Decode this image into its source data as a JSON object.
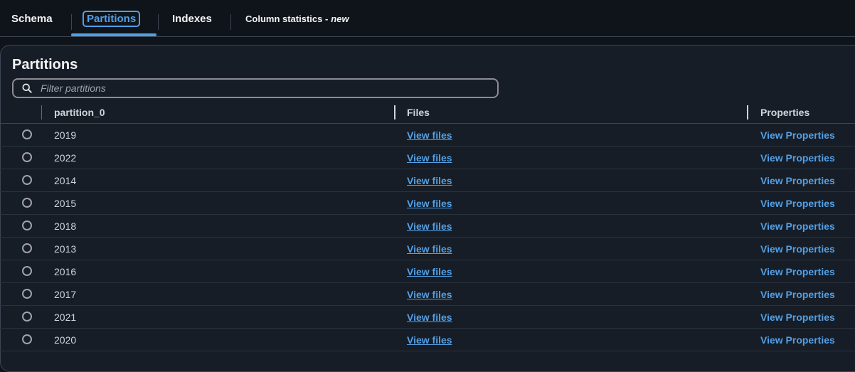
{
  "tabs": [
    {
      "label": "Schema"
    },
    {
      "label": "Partitions"
    },
    {
      "label": "Indexes"
    },
    {
      "label": "Column statistics - ",
      "badge": "new"
    }
  ],
  "section": {
    "title": "Partitions",
    "filter_placeholder": "Filter partitions"
  },
  "table": {
    "columns": [
      "partition_0",
      "Files",
      "Properties"
    ],
    "rows": [
      {
        "value": "2019",
        "files": "View files",
        "properties": "View Properties"
      },
      {
        "value": "2022",
        "files": "View files",
        "properties": "View Properties"
      },
      {
        "value": "2014",
        "files": "View files",
        "properties": "View Properties"
      },
      {
        "value": "2015",
        "files": "View files",
        "properties": "View Properties"
      },
      {
        "value": "2018",
        "files": "View files",
        "properties": "View Properties"
      },
      {
        "value": "2013",
        "files": "View files",
        "properties": "View Properties"
      },
      {
        "value": "2016",
        "files": "View files",
        "properties": "View Properties"
      },
      {
        "value": "2017",
        "files": "View files",
        "properties": "View Properties"
      },
      {
        "value": "2021",
        "files": "View files",
        "properties": "View Properties"
      },
      {
        "value": "2020",
        "files": "View files",
        "properties": "View Properties"
      }
    ]
  },
  "colors": {
    "background": "#0f141a",
    "panel": "#161d26",
    "accent": "#539fe5"
  }
}
